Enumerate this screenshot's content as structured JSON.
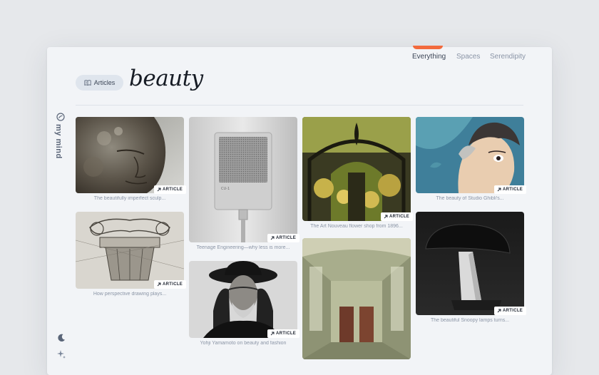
{
  "tabs": {
    "everything": "Everything",
    "spaces": "Spaces",
    "serendipity": "Serendipity"
  },
  "header": {
    "filter_label": "Articles",
    "query": "beauty"
  },
  "brand": {
    "name": "my mind"
  },
  "colors": {
    "accent": "#f26a3d",
    "text": "#161b24",
    "muted": "#8b95a6"
  },
  "badge_label": "ARTICLE",
  "cards": [
    {
      "caption": "The beautifully imperfect sculp..."
    },
    {
      "caption": "How perspective drawing plays..."
    },
    {
      "caption": "Teenage Engineering—why less is more..."
    },
    {
      "caption": "Yohji Yamamoto on beauty and fashion"
    },
    {
      "caption": "The Art Nouveau flower shop from 1896..."
    },
    {
      "caption": "The beauty of Studio Ghibli's..."
    },
    {
      "caption": "The beautiful Snoopy lamps turns..."
    }
  ],
  "mic_model_text": "CU-1",
  "icons": {
    "filter": "book-icon",
    "brand": "mymind-logo-icon",
    "badge": "external-arrow-icon",
    "theme": "moon-icon",
    "serendipity": "sparkle-icon"
  }
}
